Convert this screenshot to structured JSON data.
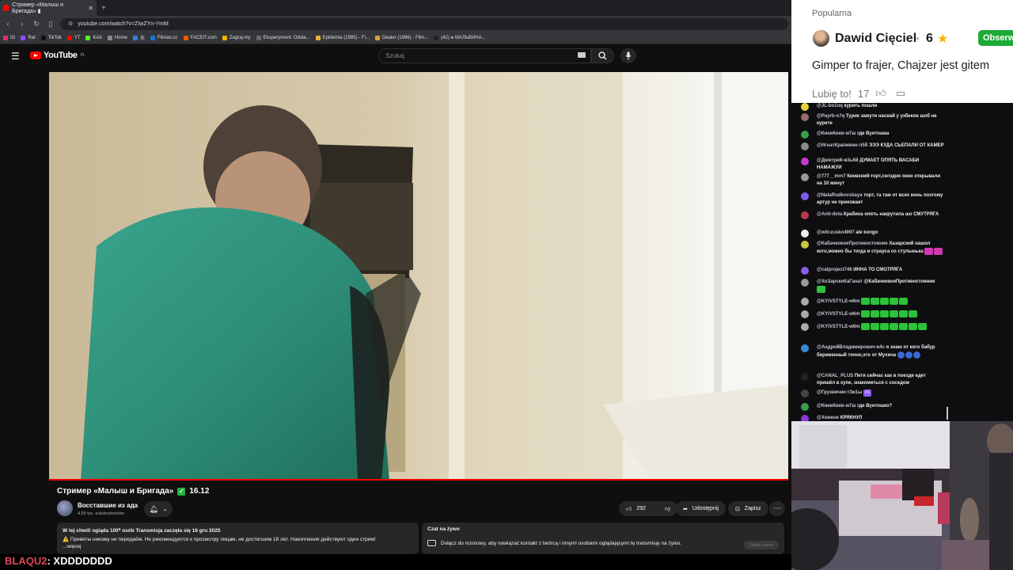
{
  "browser": {
    "tab_title": "Стример «Малыш и Бригада» ▮",
    "url": "youtube.com/watch?v=ZIwZYn-YmM",
    "bookmarks": [
      "IG",
      "Rat",
      "TikTok",
      "YT",
      "Kick",
      "Home",
      "天",
      "Filman.cc",
      "FACEIT.com",
      "Zagraj.my",
      "Eksperyment: Odsła...",
      "Epidemia (1995) - Fi...",
      "Dealer (1996) - Film...",
      "(42) ● МАЛЬВИНА..."
    ]
  },
  "youtube": {
    "logo": "YouTube",
    "logo_region": "PL",
    "search_placeholder": "Szukaj",
    "video_title": "Стример «Малыш и Бригада»",
    "title_suffix": "16.12",
    "channel_name": "Восставшие из ада",
    "subscribers": "4,55 tys. subskrybentów",
    "likes": "292",
    "share_label": "Udostępnij",
    "save_label": "Zapisz",
    "desc_line1_bold": "W tej chwili ogląda 100⁰ osób  Transmisja zaczęła się 16 gru 2025",
    "desc_line2": "⚠️ Приветы никому не передаём. Не рекомендуется к просмотру лицам, не достигшим 18 лет. Накопления действуют один стрим!",
    "desc_more": "...więcej",
    "live_chat_title": "Czat na żywo",
    "live_chat_text": "Dołącz do rozmowy, aby nawiązać kontakt z twórcą i innymi osobami oglądającymi tę transmisję na żywo.",
    "live_chat_button": "Otwórz panel",
    "playback_progress": 1.0
  },
  "overlay": {
    "user": "BLAQU2",
    "message": ": XDDDDDDD"
  },
  "card": {
    "label": "Popularna",
    "author": "Dawid Cięciel",
    "score": "6",
    "star": "★",
    "follow": "Obserw",
    "body": "Gimper to frajer, Chajzer jest gitem",
    "likes_label": "Lubię to!",
    "likes_count": "17"
  },
  "chat": [
    {
      "user": "@JL-bo1oq",
      "text": "курить пошли",
      "color": "#e8d23a"
    },
    {
      "user": "@Payrb-o7q",
      "text": "Турик замути насвай у узбеков шоб не курите",
      "color": "#9c6b6b"
    },
    {
      "user": "@КиевКиев-м7ш",
      "text": "где Вунтошка",
      "color": "#3a9c4a"
    },
    {
      "user": "@ИгнатКрапивин-л5б",
      "text": "ЭЭЭ КУДА СЬЕПАЛИ ОТ КАМЕР",
      "color": "#8a8a8a"
    },
    {
      "user": "@Дмитрий-ж3ь6й",
      "text": "ДУМАЕТ ОПЯТЬ ВАСАБИ НАМАЖУИ",
      "color": "#c43ad4"
    },
    {
      "user": "@777__mm7",
      "text": "Киевский-торт,сегодня окно открывали на 10 минут",
      "color": "#999"
    },
    {
      "user": "@NataRudkovskaya",
      "text": "торт, та там от всех вонь позтому артур не приезжает",
      "color": "#7c5ce8"
    },
    {
      "user": "@Anti-dota",
      "text": "Крабиха опять накрутила шо СМУТРЯГА",
      "color": "#b83a4a"
    },
    {
      "user": "@wilczusko4997",
      "text": "ale kongo",
      "color": "#eee"
    },
    {
      "user": "@КабачковоеПротивостояние",
      "text": "Хазарский нашол кого,можно бы тогда и страуса со ступынька",
      "color": "#c8c83a"
    },
    {
      "user": "@catproject746",
      "text": "ИННА ТО СМОТРЯГА",
      "color": "#8a5ce8"
    },
    {
      "user": "@ХоЗарскиКаГанат",
      "text": "@КабачковоеПротивостояние",
      "color": "#999"
    },
    {
      "user": "@KYIVSTYLE-w6m",
      "text": "",
      "color": "#aaa"
    },
    {
      "user": "@KYIVSTYLE-w6m",
      "text": "",
      "color": "#aaa"
    },
    {
      "user": "@KYIVSTYLE-w6m",
      "text": "",
      "color": "#aaa"
    },
    {
      "user": "@АндрейВладимирович-в4с",
      "text": "я знаю от кого бабур беременный точно,это от Мухича",
      "color": "#3a8ad4"
    },
    {
      "user": "@CANAL_PLUS",
      "text": "Петя сейчас как в поезде едет пришёл в купе, знакомиться с соседом",
      "color": "#222"
    },
    {
      "user": "@Грузвичик-т3ж1ы",
      "text": "",
      "color": "#444"
    },
    {
      "user": "@КиевКиев-м7ш",
      "text": "где Вунтошко?",
      "color": "#3a9c4a"
    },
    {
      "user": "@Хомене",
      "text": "КРЯКНУЛ",
      "color": "#8a3ad4"
    }
  ],
  "chat_badge": "#1"
}
